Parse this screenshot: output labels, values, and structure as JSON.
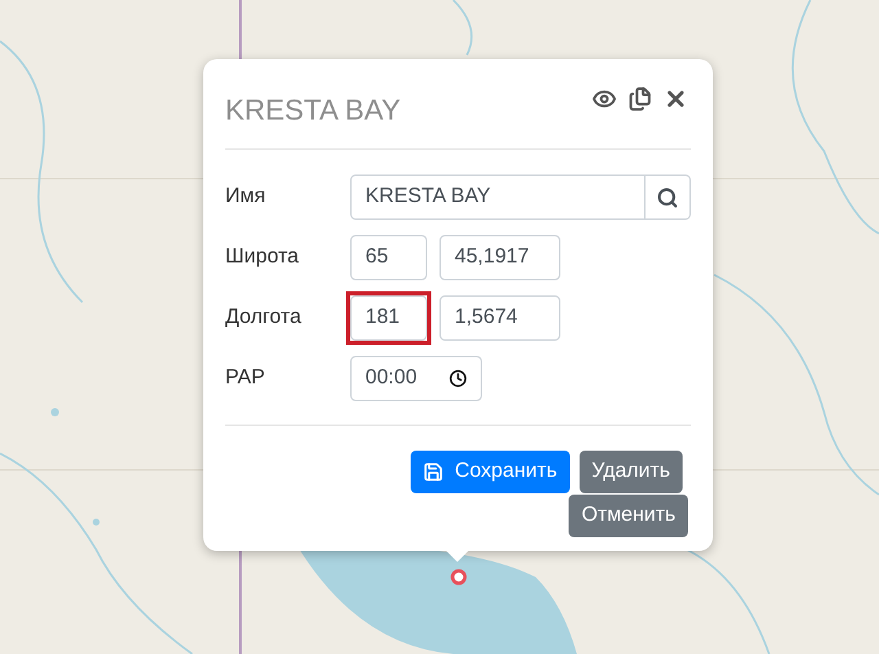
{
  "popup": {
    "title": "KRESTA BAY",
    "header_actions": [
      {
        "kind": "view"
      },
      {
        "kind": "copy"
      },
      {
        "kind": "close"
      }
    ],
    "rows": [
      {
        "label": "Имя",
        "kind": "search",
        "fields": [
          {
            "value": "KRESTA BAY",
            "highlighted": false
          }
        ]
      },
      {
        "label": "Широта",
        "kind": "pair",
        "fields": [
          {
            "value": "65",
            "highlighted": false
          },
          {
            "value": "45,1917",
            "highlighted": false
          }
        ]
      },
      {
        "label": "Долгота",
        "kind": "pair",
        "fields": [
          {
            "value": "181",
            "highlighted": true
          },
          {
            "value": "1,5674",
            "highlighted": false
          }
        ]
      },
      {
        "label": "PAP",
        "kind": "time",
        "fields": [
          {
            "value": "00:00",
            "highlighted": false
          }
        ]
      }
    ],
    "buttons": [
      {
        "label": "Сохранить",
        "kind": "primary"
      },
      {
        "label": "Удалить",
        "kind": "secondary"
      },
      {
        "label": "Отменить",
        "kind": "secondary"
      }
    ]
  }
}
